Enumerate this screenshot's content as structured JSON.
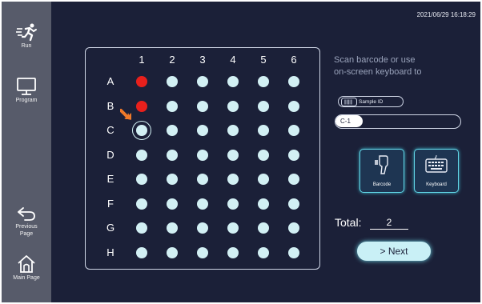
{
  "sidebar": {
    "items": [
      {
        "label": "Run",
        "icon": "running-person-icon"
      },
      {
        "label": "Program",
        "icon": "monitor-icon"
      },
      {
        "label": "Previous Page",
        "icon": "back-arrow-icon"
      },
      {
        "label": "Main Page",
        "icon": "home-icon"
      }
    ]
  },
  "header": {
    "timestamp": "2021/06/29 16:18:29"
  },
  "plate": {
    "columns": [
      "1",
      "2",
      "3",
      "4",
      "5",
      "6"
    ],
    "rows": [
      "A",
      "B",
      "C",
      "D",
      "E",
      "F",
      "G",
      "H"
    ],
    "filled_wells": [
      "A1",
      "B1"
    ],
    "selected_well": "C1",
    "colors": {
      "empty": "#d2f0f4",
      "filled": "#e8201c",
      "pointer": "#f07a2a"
    }
  },
  "instructions": {
    "line1": "Scan barcode or use",
    "line2": "on-screen keyboard to"
  },
  "sample": {
    "label": "Sample ID",
    "value": "C-1"
  },
  "buttons": {
    "barcode": "Barcode",
    "keyboard": "Keyboard",
    "next": "> Next"
  },
  "total": {
    "label": "Total:",
    "value": "2"
  },
  "colors": {
    "background": "#1b2038",
    "sidebar": "#575b6a",
    "accent": "#62d7e8"
  }
}
